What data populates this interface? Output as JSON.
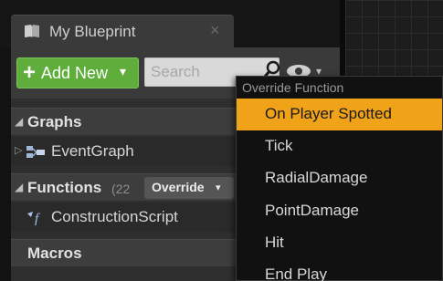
{
  "tab": {
    "title": "My Blueprint",
    "close_glyph": "×",
    "icon": "book-icon"
  },
  "toolbar": {
    "add_new_label": "Add New",
    "add_new_plus": "+",
    "add_new_caret": "▾",
    "search_placeholder": "Search",
    "search_value": "",
    "visibility_caret": "▾"
  },
  "sections": {
    "graphs": {
      "label": "Graphs",
      "caret": "◢"
    },
    "functions": {
      "label": "Functions",
      "caret": "◢",
      "count": "(22",
      "override_label": "Override",
      "override_caret": "▾"
    },
    "macros": {
      "label": "Macros"
    }
  },
  "tree": {
    "event_graph": {
      "label": "EventGraph",
      "expander": "▷",
      "icon": "event-graph-icon"
    },
    "construction_script": {
      "label": "ConstructionScript",
      "icon": "function-icon"
    }
  },
  "menu": {
    "header": "Override Function",
    "items": [
      {
        "label": "On Player Spotted",
        "selected": true
      },
      {
        "label": "Tick",
        "selected": false
      },
      {
        "label": "RadialDamage",
        "selected": false
      },
      {
        "label": "PointDamage",
        "selected": false
      },
      {
        "label": "Hit",
        "selected": false
      },
      {
        "label": "End Play",
        "selected": false
      }
    ]
  },
  "colors": {
    "accent_add": "#5fae3b",
    "menu_highlight": "#f0a318",
    "panel_bg": "#2f2f2f"
  }
}
